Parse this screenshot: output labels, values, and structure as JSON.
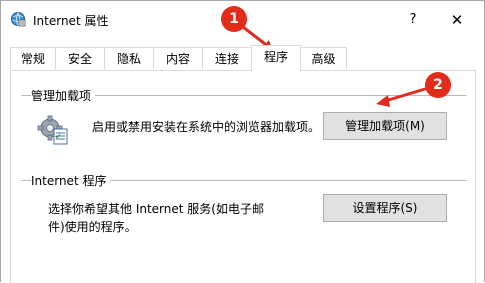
{
  "window": {
    "title": "Internet 属性",
    "help_glyph": "?",
    "close_glyph": "✕"
  },
  "tabs": [
    {
      "label": "常规",
      "active": false
    },
    {
      "label": "安全",
      "active": false
    },
    {
      "label": "隐私",
      "active": false
    },
    {
      "label": "内容",
      "active": false
    },
    {
      "label": "连接",
      "active": false
    },
    {
      "label": "程序",
      "active": true
    },
    {
      "label": "高级",
      "active": false
    }
  ],
  "addons": {
    "group_title": "管理加载项",
    "description": "启用或禁用安装在系统中的浏览器加载项。",
    "button_label": "管理加载项(M)",
    "icon": "gear-settings-icon"
  },
  "programs": {
    "group_title": "Internet 程序",
    "description_line1": "选择你希望其他 Internet 服务(如电子邮",
    "description_line2": "件)使用的程序。",
    "button_label": "设置程序(S)"
  },
  "annotations": [
    {
      "number": "1",
      "color": "#e32b1c"
    },
    {
      "number": "2",
      "color": "#e32b1c"
    }
  ]
}
